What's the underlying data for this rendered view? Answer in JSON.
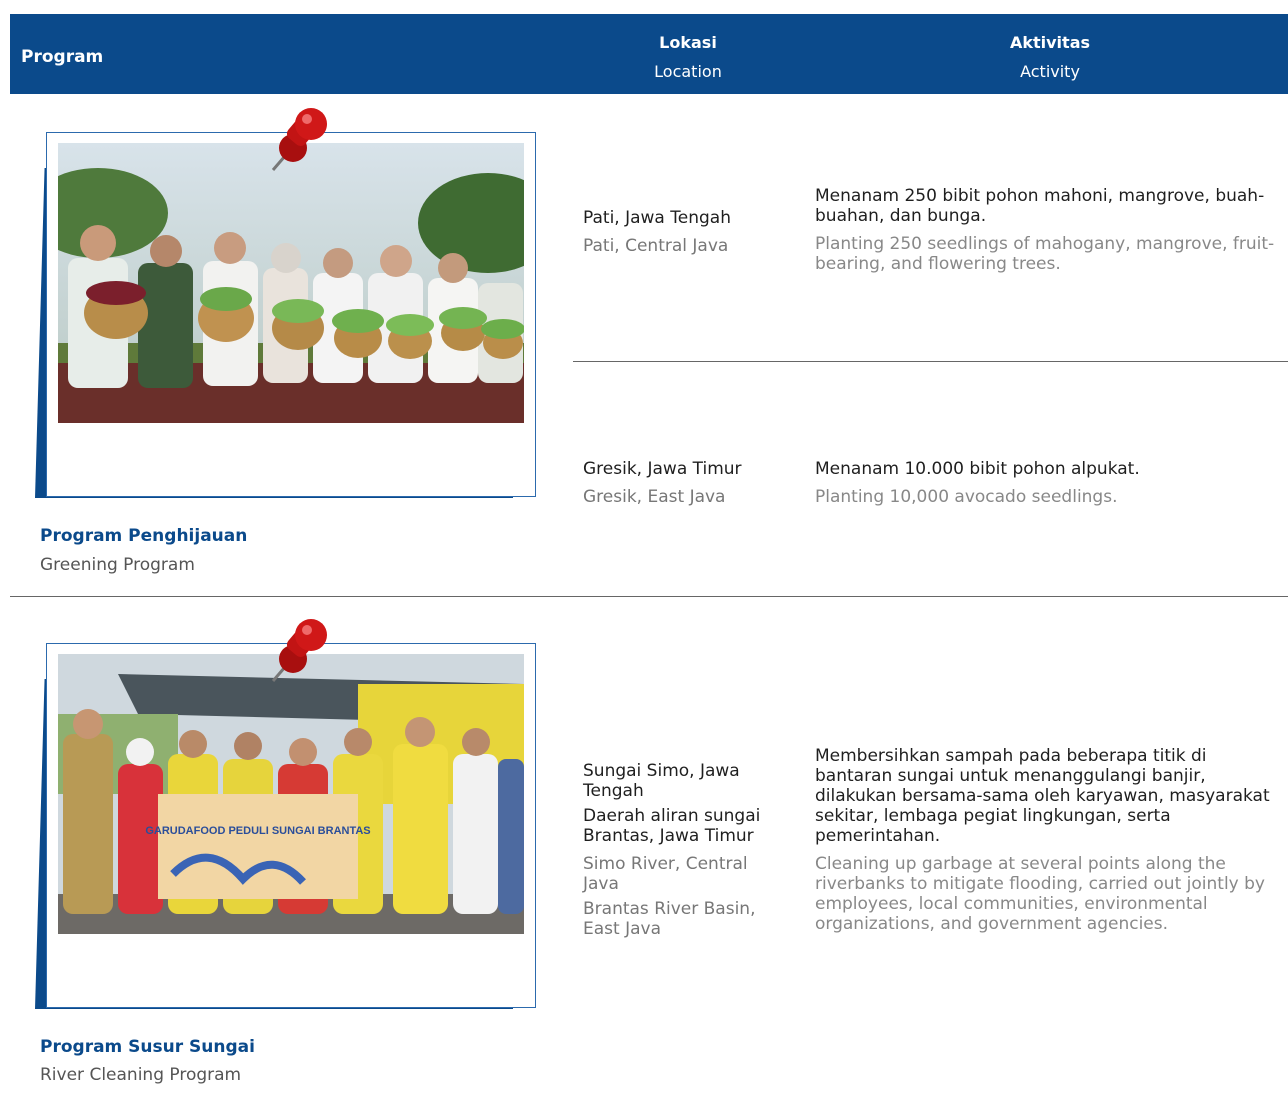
{
  "header": {
    "program_label": "Program",
    "location_label_id": "Lokasi",
    "location_label_en": "Location",
    "activity_label_id": "Aktivitas",
    "activity_label_en": "Activity"
  },
  "colors": {
    "brand": "#0b4a8b",
    "pin": "#c21414"
  },
  "programs": [
    {
      "title_id": "Program Penghijauan",
      "title_en": "Greening Program",
      "photo_icon": "greening-photo",
      "entries": [
        {
          "location_id": "Pati, Jawa Tengah",
          "location_en": "Pati, Central Java",
          "activity_id": "Menanam 250 bibit pohon mahoni, mangrove, buah-buahan, dan bunga.",
          "activity_en": "Planting 250 seedlings of mahogany, mangrove, fruit-bearing, and flowering trees."
        },
        {
          "location_id": "Gresik, Jawa Timur",
          "location_en": "Gresik, East Java",
          "activity_id": "Menanam 10.000 bibit pohon alpukat.",
          "activity_en": "Planting 10,000 avocado seedlings."
        }
      ]
    },
    {
      "title_id": "Program Susur Sungai",
      "title_en": "River Cleaning Program",
      "photo_icon": "river-cleaning-photo",
      "banner_text": "GARUDAFOOD PEDULI SUNGAI BRANTAS",
      "entries": [
        {
          "location_id_1": "Sungai Simo, Jawa Tengah",
          "location_id_2": "Daerah aliran sungai Brantas, Jawa Timur",
          "location_en_1": "Simo River, Central Java",
          "location_en_2": "Brantas River Basin, East Java",
          "activity_id": "Membersihkan sampah pada beberapa titik di bantaran sungai untuk menanggulangi banjir, dilakukan bersama-sama oleh karyawan, masyarakat sekitar, lembaga pegiat lingkungan, serta pemerintahan.",
          "activity_en": "Cleaning up garbage at several points along the riverbanks to mitigate flooding, carried out jointly by employees, local communities, environmental organizations, and government agencies."
        }
      ]
    }
  ]
}
